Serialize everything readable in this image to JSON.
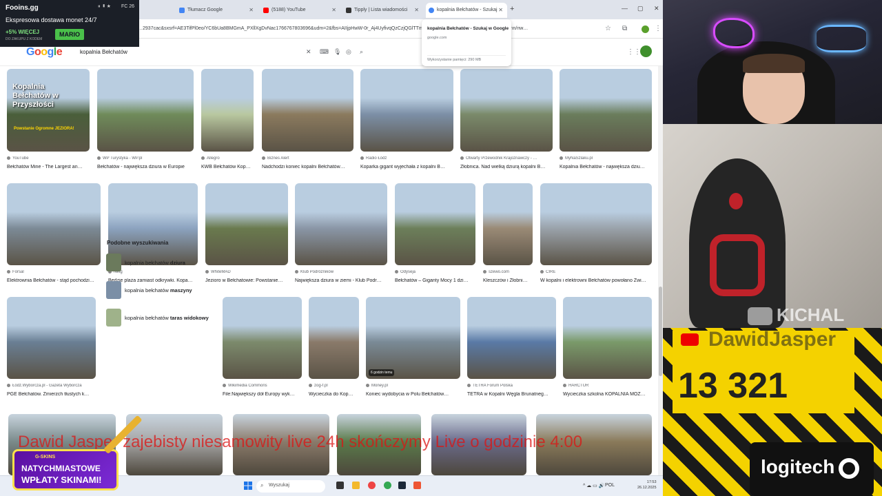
{
  "overlay_top": {
    "brand": "Fooins.gg",
    "fc": "FC 26",
    "status_icons": "⏸ ▮ ★",
    "line": "Ekspresowa dostawa monet 24/7",
    "promo": "+5% WIĘCEJ",
    "promo_sub": "DO ZAKUPU Z KODEM",
    "code": "MARIO"
  },
  "tabs": [
    {
      "label": "Tłumacz Google",
      "color": "#4285f4"
    },
    {
      "label": "(5188) YouTube",
      "color": "#ff0000"
    },
    {
      "label": "Tipply | Lista wiadomości",
      "color": "#333333"
    },
    {
      "label": "kopalnia Bełchatów - Szukaj",
      "color": "#4285f4"
    }
  ],
  "new_tab": "+",
  "window_controls": {
    "min": "—",
    "max": "▢",
    "close": "✕"
  },
  "url": "…2937cac&sxsrf=AE3TifPl0eo/YC6bUa8BMGmA_PXllXgDvNac1766767803696&udm=2&fbs=AIIjpHwW-0r_Aj4UyfivqQzCzjQGlTTmC23…Os7Ruop-S7Tb/6b6Qv0xZRA1B3mn/nw…",
  "tab_popup": {
    "title": "kopalnia Bełchatów - Szukaj w Google",
    "domain": "google.com",
    "memory": "Wykorzystanie pamięci: 290 MB"
  },
  "google": {
    "logo": "Google",
    "query": "kopalnia Bełchatów",
    "logo_colors": [
      "#4285f4",
      "#ea4335",
      "#fbbc05",
      "#4285f4",
      "#34a853",
      "#ea4335"
    ]
  },
  "row1": [
    {
      "src": "YouTube",
      "title": "Bełchatów Mine - The Largest an…",
      "overlay": "Kopalnia Bełchatów w Przyszłości",
      "overlay_sub": "Powstanie Ogromne JEZIORA!",
      "color": "#4a5f3a"
    },
    {
      "src": "WP Turystyka - WP.pl",
      "title": "Bełchatów - największa dziura w Europie",
      "color": "#6f8b5a"
    },
    {
      "src": "Allegro",
      "title": "KWB Bełchatów Kop…",
      "color": "#b9c8a0"
    },
    {
      "src": "Biznes Alert",
      "title": "Nadchodzi koniec kopalni Bełchatów…",
      "color": "#8b7a5e"
    },
    {
      "src": "Radio Łódź",
      "title": "Koparka gigant wyjechała z kopalni B…",
      "color": "#7c8fa6"
    },
    {
      "src": "Otwarty Przewodnik Krajoznawczy - …",
      "title": "Złobnica. Nad wielką dziurą kopalni B…",
      "color": "#7a8a6a"
    },
    {
      "src": "MyNaSzlaku.pl",
      "title": "Kopalnia Bełchatów - największa dziu…",
      "color": "#6a7d5c"
    }
  ],
  "row2": [
    {
      "src": "Forsal",
      "title": "Elektrownia Bełchatów - stąd pochodzi…",
      "color": "#7c8a96"
    },
    {
      "src": "Netg",
      "title": "Będzie plaża zamiast odkrywki. Kopa…",
      "color": "#8ca3bf"
    },
    {
      "src": "WhiteMAD",
      "title": "Jezioro w Bełchatowie: Powstanie…",
      "color": "#6a7a4e"
    },
    {
      "src": "Klub Podróżników",
      "title": "Największa dziura w ziemi - Klub Podr…",
      "color": "#8a96a6"
    },
    {
      "src": "Odyseja",
      "title": "Bełchatów – Giganty Mocy 1 dzi…",
      "color": "#6c7f5a"
    },
    {
      "src": "szewo.com",
      "title": "Kleszczów i Złobni…",
      "color": "#9a8a76"
    },
    {
      "src": "CIRE",
      "title": "W kopalni i elektrowni Bełchatów powołano Zwi…",
      "color": "#9aa2aa"
    }
  ],
  "related": {
    "header": "Podobne wyszukiwania",
    "items": [
      {
        "base": "kopalnia bełchatów",
        "bold": "dziura"
      },
      {
        "base": "kopalnia bełchatów",
        "bold": "maszyny"
      },
      {
        "base": "kopalnia bełchatów",
        "bold": "taras widokowy"
      }
    ]
  },
  "row3": [
    {
      "src": "Łódź.Wyborcza.pl - Gazeta Wyborcza",
      "title": "PGE Bełchatów. Zmierzch tłustych k…",
      "color": "#6a7f94"
    },
    {
      "src": "Wikimedia Commons",
      "title": "File:Największy dół Europy wyk…",
      "color": "#7c8a6c"
    },
    {
      "src": "zog-f.pl",
      "title": "Wycieczka do Kop…",
      "color": "#8a7a6a"
    },
    {
      "src": "Money.pl",
      "title": "Koniec wydobycia w Polu Bełchatów…",
      "badge": "6 godzin temu",
      "color": "#7a8a96"
    },
    {
      "src": "TETRA Forum Polska",
      "title": "TETRA w Kopalni Węgla Brunatneg…",
      "color": "#5a7aa6"
    },
    {
      "src": "HARCTUR",
      "title": "Wycieczka szkolna KOPALNIA MOŻ…",
      "color": "#7a9a6a"
    }
  ],
  "row4_colors": [
    "#7a8a8a",
    "#a6a6a6",
    "#8a7a6a",
    "#5a7a4a",
    "#6a6a8a",
    "#8a7a5a"
  ],
  "taskbar": {
    "search_placeholder": "Wyszukaj",
    "lang": "POL",
    "time": "17:53",
    "date": "26.12.2025",
    "tray": "^ ☁ ▭ 🔊"
  },
  "webcam": {
    "channel": "KICHAL"
  },
  "yt_counter": {
    "name": "DawidJasper",
    "count": "13 321"
  },
  "logitech": "logitech",
  "ticker": "Dawid Jasper zajebisty niesamowity live 24h skończymy Live o godzinie 4:00",
  "promo_bl": {
    "brand": "G-SKINS",
    "line1": "NATYCHMIASTOWE",
    "line2": "WPŁATY SKINAMI!"
  }
}
